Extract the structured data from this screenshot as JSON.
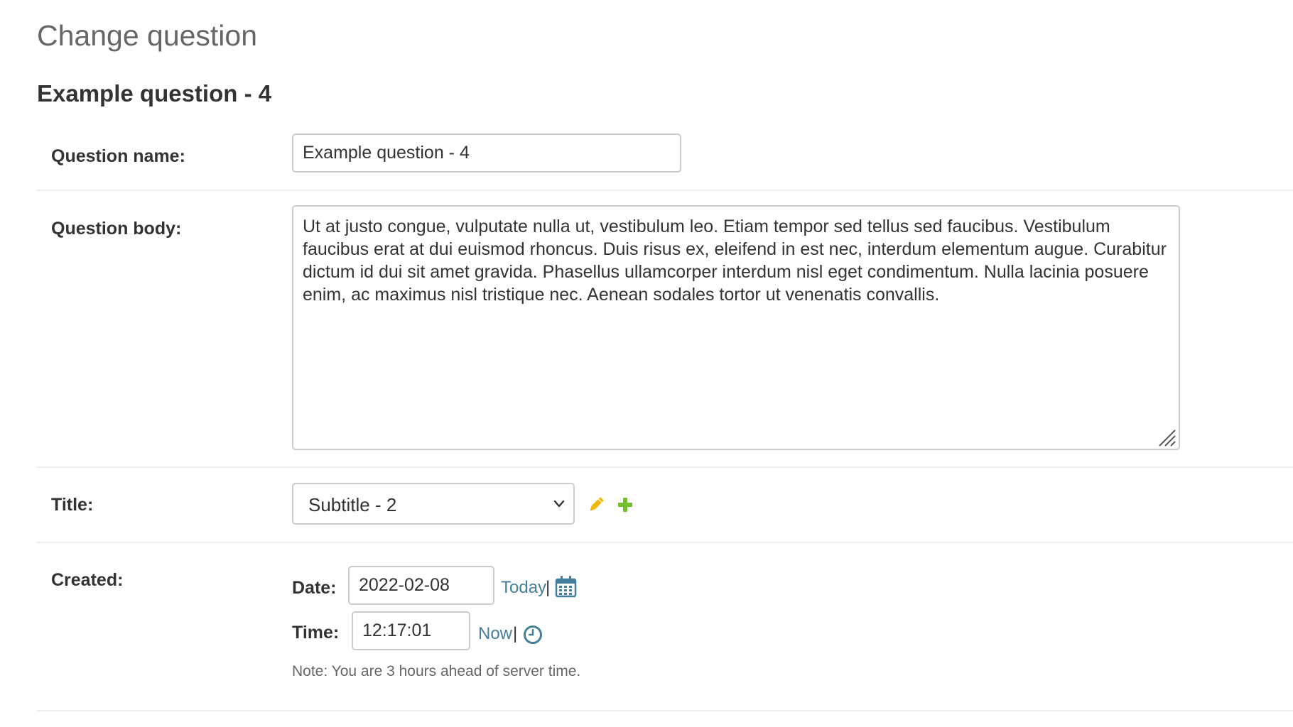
{
  "page": {
    "title": "Change question"
  },
  "fieldset": {
    "heading": "Example question - 4"
  },
  "fields": {
    "question_name": {
      "label": "Question name:",
      "value": "Example question - 4"
    },
    "question_body": {
      "label": "Question body:",
      "value": "Ut at justo congue, vulputate nulla ut, vestibulum leo. Etiam tempor sed tellus sed faucibus. Vestibulum faucibus erat at dui euismod rhoncus. Duis risus ex, eleifend in est nec, interdum elementum augue. Curabitur dictum id dui sit amet gravida. Phasellus ullamcorper interdum nisl eget condimentum. Nulla lacinia posuere enim, ac maximus nisl tristique nec. Aenean sodales tortor ut venenatis convallis."
    },
    "title": {
      "label": "Title:",
      "selected": "Subtitle - 2",
      "edit_icon": "pencil-icon",
      "add_icon": "plus-icon"
    },
    "created": {
      "label": "Created:",
      "date_label": "Date:",
      "date_value": "2022-02-08",
      "today_link": "Today",
      "time_label": "Time:",
      "time_value": "12:17:01",
      "now_link": "Now",
      "separator": "|",
      "calendar_icon": "calendar-icon",
      "clock_icon": "clock-icon",
      "note": "Note: You are 3 hours ahead of server time."
    }
  },
  "colors": {
    "link": "#447e9b",
    "edit_icon": "#efb80b",
    "add_icon": "#70bf2b",
    "border": "#cccccc",
    "divider": "#eeeeee"
  }
}
